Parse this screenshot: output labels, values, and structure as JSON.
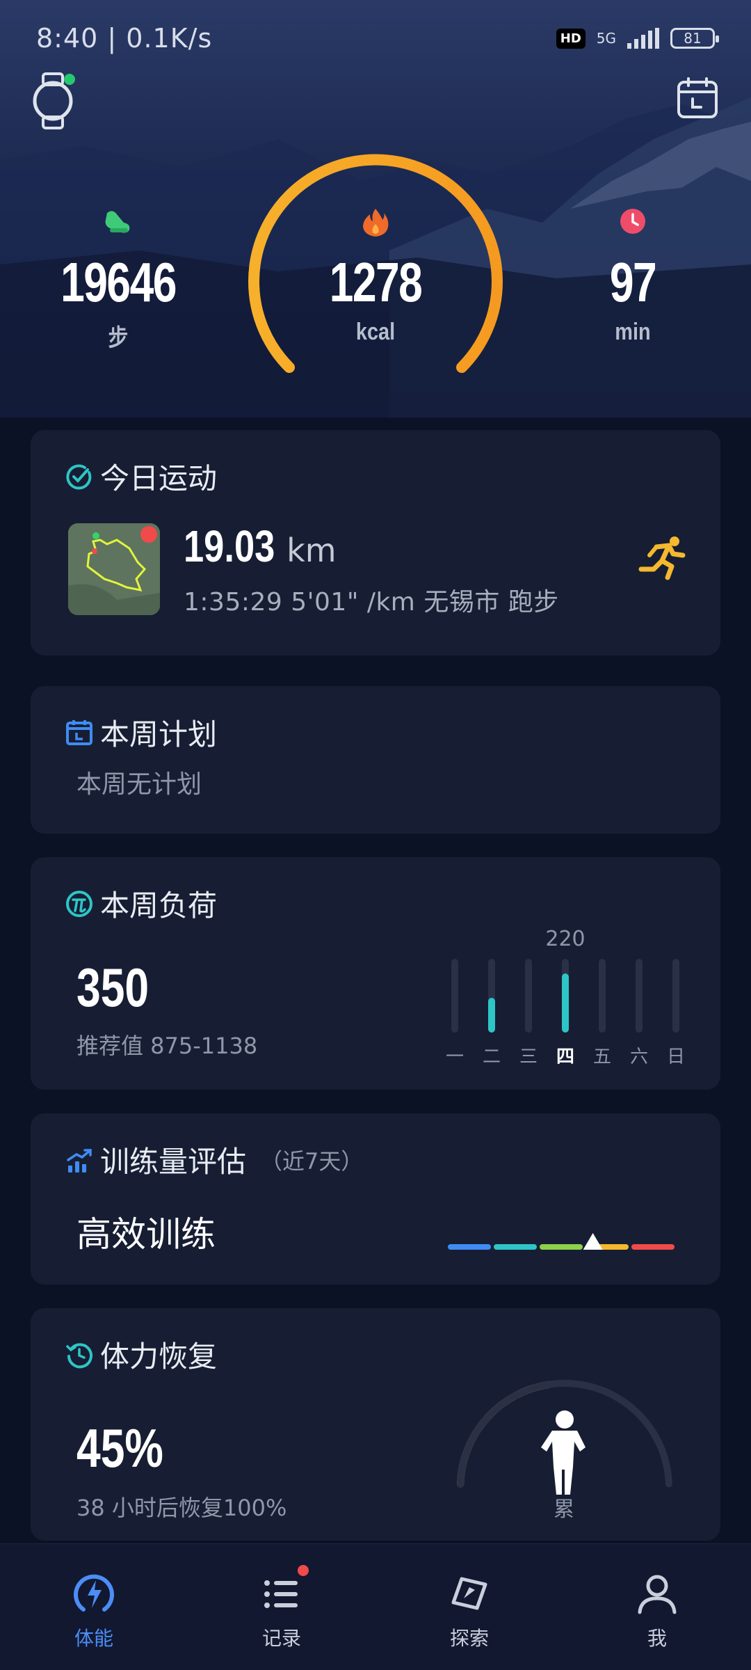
{
  "status_bar": {
    "time": "8:40 | 0.1K/s",
    "hd": "HD",
    "network": "5G",
    "battery": "81"
  },
  "summary": {
    "steps_value": "19646",
    "steps_unit": "步",
    "kcal_value": "1278",
    "kcal_unit": "kcal",
    "minutes_value": "97",
    "minutes_unit": "min"
  },
  "today": {
    "title": "今日运动",
    "distance": "19.03",
    "distance_unit": "km",
    "meta": "1:35:29 5'01\" /km  无锡市 跑步"
  },
  "plan": {
    "title": "本周计划",
    "empty_text": "本周无计划"
  },
  "load": {
    "title": "本周负荷",
    "value": "350",
    "recommend": "推荐值 875-1138",
    "peak_label": "220",
    "days": [
      {
        "label": "一",
        "value": 0
      },
      {
        "label": "二",
        "value": 130
      },
      {
        "label": "三",
        "value": 0
      },
      {
        "label": "四",
        "value": 220
      },
      {
        "label": "五",
        "value": 0
      },
      {
        "label": "六",
        "value": 0
      },
      {
        "label": "日",
        "value": 0
      }
    ],
    "current_day": "四"
  },
  "evaluation": {
    "title": "训练量评估",
    "subtitle": "（近7天）",
    "status": "高效训练",
    "scale_colors": [
      "#3f8cf3",
      "#2ec5c6",
      "#8bd14a",
      "#f5b82e",
      "#ef4b4b"
    ],
    "marker_position": 0.64
  },
  "recovery": {
    "title": "体力恢复",
    "value": "45%",
    "note": "38 小时后恢复100%",
    "state": "累",
    "progress": 0.45
  },
  "tabbar": {
    "items": [
      {
        "label": "体能",
        "icon": "energy-icon"
      },
      {
        "label": "记录",
        "icon": "list-icon"
      },
      {
        "label": "探索",
        "icon": "compass-icon"
      },
      {
        "label": "我",
        "icon": "profile-icon"
      }
    ],
    "active": "体能"
  },
  "colors": {
    "accent_blue": "#4c8df6",
    "ring_orange": "#f7a928",
    "teal": "#2ec5c6",
    "card_bg": "#171e33",
    "page_bg": "#0c1226"
  }
}
